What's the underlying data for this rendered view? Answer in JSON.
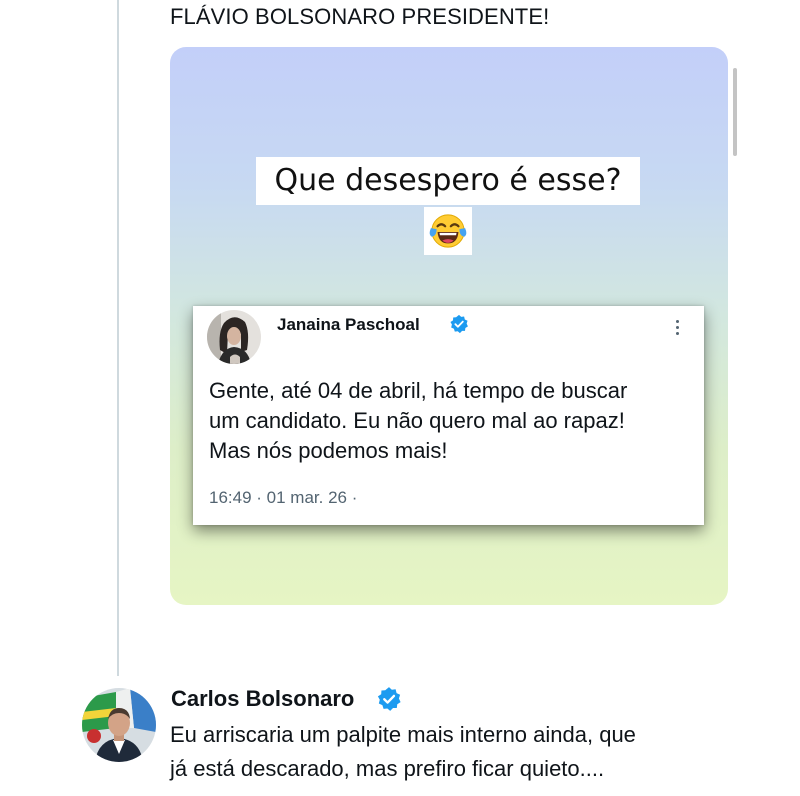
{
  "post": {
    "text": "FLÁVIO BOLSONARO PRESIDENTE!"
  },
  "media": {
    "headline": "Que desespero é esse?",
    "emoji": "face-with-tears-of-joy",
    "embedded_tweet": {
      "author_name": "Janaina Paschoal",
      "verified": true,
      "text_lines": [
        "Gente, até 04 de abril, há tempo de buscar",
        "um candidato. Eu não quero mal ao rapaz!",
        "Mas nós podemos mais!"
      ],
      "meta": "16:49 · 01 mar. 26 ·"
    }
  },
  "reply": {
    "author_name": "Carlos Bolsonaro",
    "verified": true,
    "text_lines": [
      "Eu arriscaria um palpite mais interno ainda, que",
      "já está descarado, mas prefiro ficar quieto...."
    ]
  },
  "colors": {
    "verified_blue": "#1d9bf0",
    "text_primary": "#0f1419",
    "text_secondary": "#536471"
  }
}
